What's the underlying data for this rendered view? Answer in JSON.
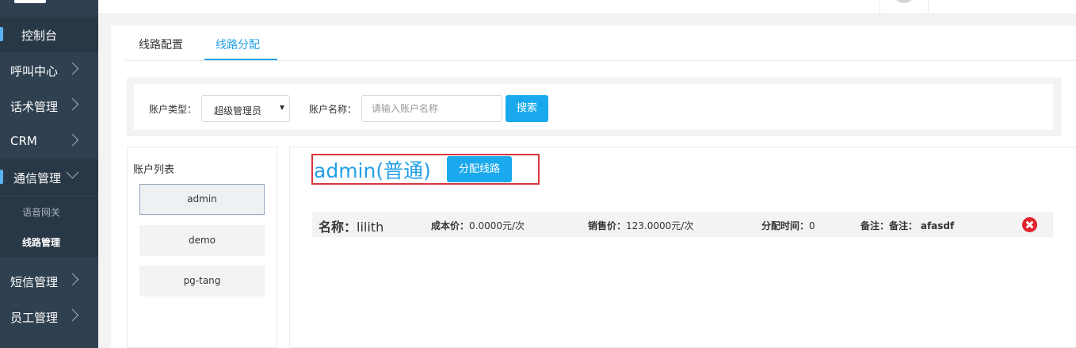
{
  "sidebar": {
    "items": [
      {
        "label": "控制台"
      },
      {
        "label": "呼叫中心"
      },
      {
        "label": "话术管理"
      },
      {
        "label": "CRM"
      },
      {
        "label": "通信管理"
      },
      {
        "label": "短信管理"
      },
      {
        "label": "员工管理"
      }
    ],
    "subitems": [
      {
        "label": "语音网关"
      },
      {
        "label": "线路管理"
      }
    ]
  },
  "tabs": [
    {
      "label": "线路配置"
    },
    {
      "label": "线路分配"
    }
  ],
  "search": {
    "type_label": "账户类型：",
    "type_value": "超级管理员",
    "name_label": "账户名称：",
    "name_placeholder": "请输入账户名称",
    "button": "搜索"
  },
  "accounts": {
    "title": "账户列表",
    "items": [
      "admin",
      "demo",
      "pg-tang"
    ],
    "selected": "admin"
  },
  "detail": {
    "title": "admin(普通)",
    "assign_button": "分配线路",
    "lines": [
      {
        "name_label": "名称：",
        "name_value": "lilith",
        "cost_label": "成本价：",
        "cost_value": "0.0000元/次",
        "sale_label": "销售价：",
        "sale_value": "123.0000元/次",
        "time_label": "分配时间：",
        "time_value": "0",
        "note_label": "备注：备注：",
        "note_value": "afasdf"
      }
    ]
  },
  "colors": {
    "sidebar_bg": "#2f4050",
    "accent": "#1aa9ec",
    "highlight_box": "#d9363e",
    "delete": "#e0232d"
  }
}
